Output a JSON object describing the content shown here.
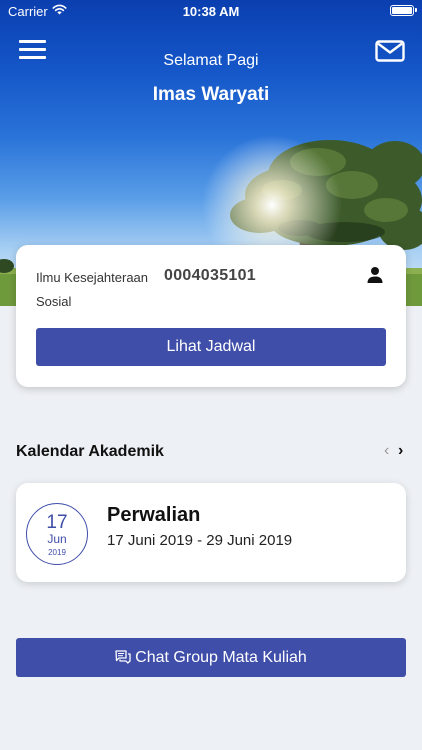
{
  "status_bar": {
    "carrier": "Carrier",
    "time": "10:38 AM"
  },
  "header": {
    "greeting": "Selamat Pagi",
    "user_name": "Imas Waryati",
    "menu_icon": "hamburger-menu-icon",
    "mail_icon": "mail-icon"
  },
  "student": {
    "major": "Ilmu Kesejahteraan Sosial",
    "nim": "0004035101",
    "icon": "person-icon",
    "schedule_button": "Lihat Jadwal"
  },
  "calendar": {
    "title": "Kalendar Akademik",
    "prev_icon": "chevron-left-icon",
    "next_icon": "chevron-right-icon",
    "prev_glyph": "‹",
    "next_glyph": "›",
    "events": [
      {
        "day": "17",
        "month": "Jun",
        "year": "2019",
        "title": "Perwalian",
        "range": "17 Juni 2019 - 29 Juni 2019"
      }
    ]
  },
  "chat_button": {
    "label": "Chat Group Mata Kuliah",
    "icon": "chat-icon"
  },
  "colors": {
    "primary": "#3f4ea8",
    "background": "#edf0f4",
    "card": "#ffffff",
    "sky": "#1455c7"
  }
}
